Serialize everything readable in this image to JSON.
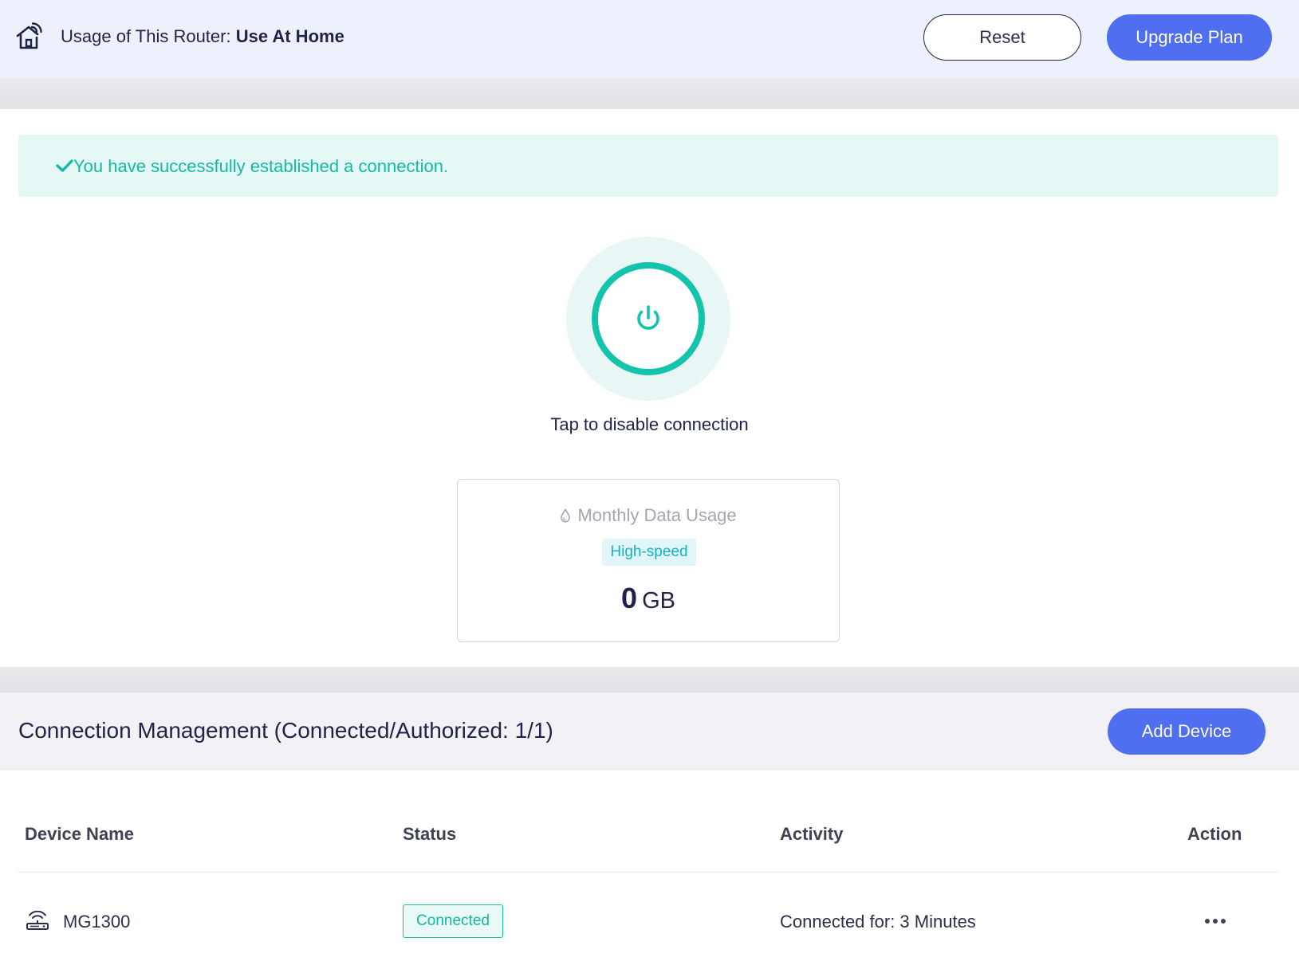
{
  "header": {
    "title_prefix": "Usage of This Router: ",
    "title_value": "Use At Home",
    "reset_label": "Reset",
    "upgrade_label": "Upgrade Plan"
  },
  "alert": {
    "message": "You have successfully established a connection."
  },
  "power": {
    "caption": "Tap to disable connection"
  },
  "usage": {
    "title": "Monthly Data Usage",
    "badge": "High-speed",
    "value": "0",
    "unit": "GB"
  },
  "connections": {
    "title": "Connection Management (Connected/Authorized: 1/1)",
    "add_label": "Add Device",
    "columns": [
      "Device Name",
      "Status",
      "Activity",
      "Action"
    ],
    "rows": [
      {
        "device": "MG1300",
        "status": "Connected",
        "activity": "Connected for: 3 Minutes"
      }
    ]
  },
  "colors": {
    "accent": "#4f6ef0",
    "success": "#13c4aa",
    "header_bg": "#edf1fc"
  },
  "icons": [
    "home-wifi-icon",
    "check-icon",
    "power-icon",
    "droplet-icon",
    "router-icon",
    "more-icon"
  ]
}
